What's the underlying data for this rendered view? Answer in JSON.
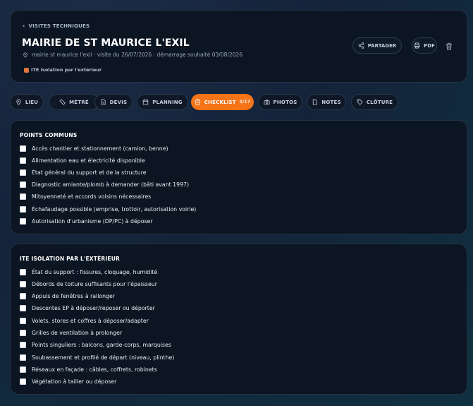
{
  "header": {
    "back_label": "VISITES TECHNIQUES",
    "title": "MAIRIE DE ST MAURICE L'EXIL",
    "meta": "mairie st maurice l'exil · visite du 26/07/2026 · démarrage souhaité 03/08/2026",
    "tag": "ITE Isolation par l'extérieur",
    "share_label": "PARTAGER",
    "pdf_label": "PDF"
  },
  "tabs": [
    {
      "label": "LIEU",
      "icon": "pin-icon"
    },
    {
      "label": "MÉTRÉ",
      "icon": "ruler-icon"
    },
    {
      "label": "DEVIS",
      "icon": "document-icon"
    },
    {
      "label": "PLANNING",
      "icon": "calendar-icon"
    },
    {
      "label": "CHECKLIST",
      "count": "0/17",
      "icon": "clipboard-icon",
      "active": true
    },
    {
      "label": "PHOTOS",
      "icon": "camera-icon"
    },
    {
      "label": "NOTES",
      "icon": "note-icon"
    },
    {
      "label": "CLÔTURE",
      "icon": "tag-icon"
    }
  ],
  "sections": [
    {
      "title": "POINTS COMMUNS",
      "items": [
        "Accès chantier et stationnement (camion, benne)",
        "Alimentation eau et électricité disponible",
        "État général du support et de la structure",
        "Diagnostic amiante/plomb à demander (bâti avant 1997)",
        "Mitoyenneté et accords voisins nécessaires",
        "Échafaudage possible (emprise, trottoir, autorisation voirie)",
        "Autorisation d'urbanisme (DP/PC) à déposer"
      ]
    },
    {
      "title": "ITE ISOLATION PAR L'EXTÉRIEUR",
      "items": [
        "État du support : fissures, cloquage, humidité",
        "Débords de toiture suffisants pour l'épaisseur",
        "Appuis de fenêtres à rallonger",
        "Descentes EP à déposer/reposer ou déporter",
        "Volets, stores et coffres à déposer/adapter",
        "Grilles de ventilation à prolonger",
        "Points singuliers : balcons, garde-corps, marquises",
        "Soubassement et profilé de départ (niveau, plinthe)",
        "Réseaux en façade : câbles, coffrets, robinets",
        "Végétation à tailler ou déposer"
      ]
    }
  ],
  "colors": {
    "accent": "#f57418",
    "card_bg": "#0c1522",
    "page_bg": "#14233a"
  }
}
